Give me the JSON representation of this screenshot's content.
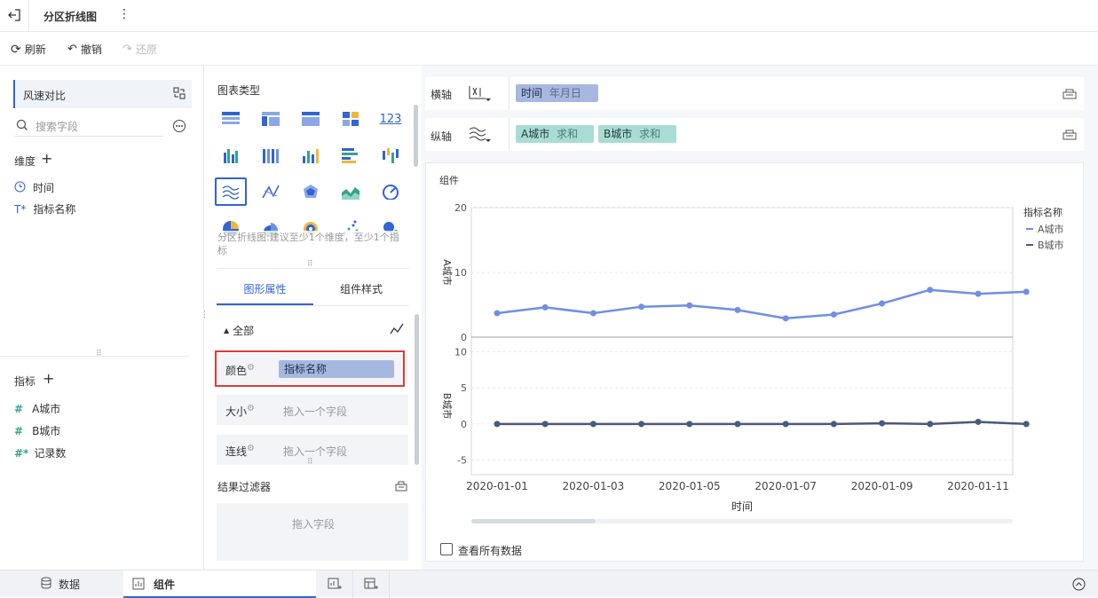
{
  "header": {
    "title": "分区折线图"
  },
  "toolbar": {
    "refresh": "刷新",
    "undo": "撤销",
    "redo": "还原"
  },
  "left_panel": {
    "dataset": "风速对比",
    "search_placeholder": "搜索字段",
    "dimension_title": "维度",
    "dimensions": [
      "时间",
      "指标名称"
    ],
    "measure_title": "指标",
    "measures": [
      "A城市",
      "B城市",
      "记录数"
    ]
  },
  "mid_panel": {
    "chart_type_title": "图表类型",
    "hint": "分区折线图:建议至少1个维度，至少1个指标",
    "tabs": [
      "图形属性",
      "组件样式"
    ],
    "all_label": "全部",
    "props": [
      {
        "label": "颜色",
        "value": "指标名称"
      },
      {
        "label": "大小",
        "value": "拖入一个字段"
      },
      {
        "label": "连线",
        "value": "拖入一个字段"
      }
    ],
    "filter_title": "结果过滤器",
    "filter_placeholder": "拖入字段"
  },
  "axes": {
    "x_label": "横轴",
    "y_label": "纵轴",
    "x_fields": [
      {
        "name": "时间",
        "sub": "年月日"
      }
    ],
    "y_fields": [
      {
        "name": "A城市",
        "sub": "求和"
      },
      {
        "name": "B城市",
        "sub": "求和"
      }
    ]
  },
  "component": {
    "title": "组件",
    "view_all": "查看所有数据"
  },
  "chart_data": {
    "type": "line",
    "xlabel": "时间",
    "x_ticks": [
      "2020-01-01",
      "2020-01-03",
      "2020-01-05",
      "2020-01-07",
      "2020-01-09",
      "2020-01-11"
    ],
    "x": [
      "2020-01-01",
      "2020-01-02",
      "2020-01-03",
      "2020-01-04",
      "2020-01-05",
      "2020-01-06",
      "2020-01-07",
      "2020-01-08",
      "2020-01-09",
      "2020-01-10",
      "2020-01-11",
      "2020-01-12"
    ],
    "legend_title": "指标名称",
    "series": [
      {
        "name": "A城市",
        "color": "#6f8fe3",
        "ylabel": "A城市",
        "ylim": [
          0,
          20
        ],
        "yticks": [
          0,
          10,
          20
        ],
        "values": [
          3.7,
          4.6,
          3.7,
          4.7,
          4.9,
          4.2,
          2.9,
          3.5,
          5.2,
          7.3,
          6.7,
          7.0
        ]
      },
      {
        "name": "B城市",
        "color": "#4a5a78",
        "ylabel": "B城市",
        "ylim": [
          -7,
          12
        ],
        "yticks": [
          -5,
          0,
          5,
          10
        ],
        "values": [
          0,
          0,
          0,
          0,
          0,
          0,
          0,
          0,
          0.1,
          0,
          0.3,
          0
        ]
      }
    ]
  },
  "bottom_tabs": [
    "数据",
    "组件"
  ]
}
